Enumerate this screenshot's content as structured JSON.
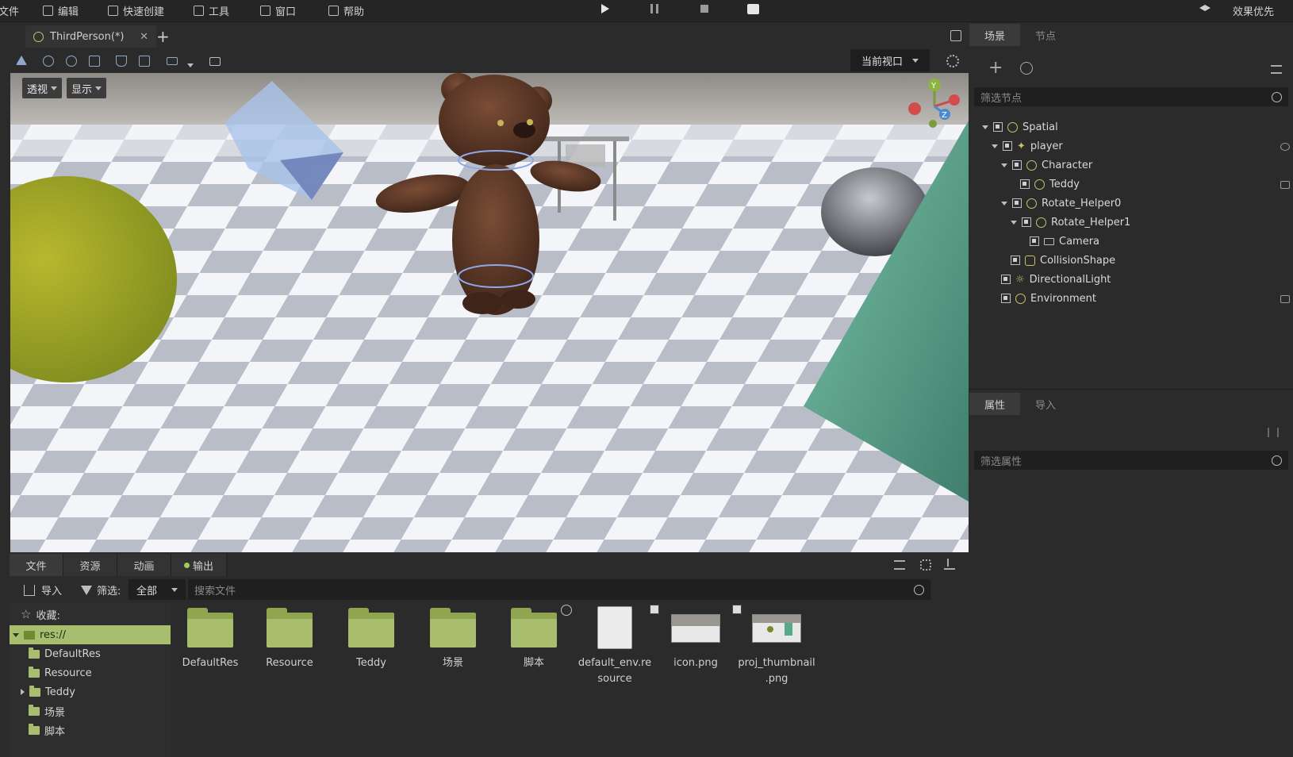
{
  "menubar": {
    "items": [
      "文件",
      "编辑",
      "快速创建",
      "工具",
      "窗口",
      "帮助"
    ],
    "right_label": "效果优先"
  },
  "editor_tabs": {
    "scene_tab": "ThirdPerson(*)",
    "add_tab": "+"
  },
  "toolbar": {
    "viewport_select": "当前视口"
  },
  "viewport": {
    "perspective_btn": "透视",
    "display_btn": "显示",
    "gizmo": {
      "y": "Y",
      "z": "Z"
    }
  },
  "bottom_panel": {
    "tabs": [
      "文件",
      "资源",
      "动画",
      "输出"
    ],
    "import_label": "导入",
    "filter_label": "筛选:",
    "filter_value": "全部",
    "search_placeholder": "搜索文件",
    "favorites_label": "收藏:",
    "tree": [
      {
        "label": "res://",
        "selected": true
      },
      {
        "label": "DefaultRes"
      },
      {
        "label": "Resource"
      },
      {
        "label": "Teddy"
      },
      {
        "label": "场景"
      },
      {
        "label": "脚本"
      }
    ],
    "files": [
      {
        "name": "DefaultRes",
        "type": "folder"
      },
      {
        "name": "Resource",
        "type": "folder"
      },
      {
        "name": "Teddy",
        "type": "folder"
      },
      {
        "name": "场景",
        "type": "folder"
      },
      {
        "name": "脚本",
        "type": "folder"
      },
      {
        "name": "default_env.re\nsource",
        "type": "resource"
      },
      {
        "name": "icon.png",
        "type": "image"
      },
      {
        "name": "proj_thumbnail\n.png",
        "type": "image"
      }
    ]
  },
  "scene_panel": {
    "tabs": [
      "场景",
      "节点"
    ],
    "filter_placeholder": "筛选节点",
    "nodes": [
      {
        "label": "Spatial"
      },
      {
        "label": "player"
      },
      {
        "label": "Character"
      },
      {
        "label": "Teddy"
      },
      {
        "label": "Rotate_Helper0"
      },
      {
        "label": "Rotate_Helper1"
      },
      {
        "label": "Camera"
      },
      {
        "label": "CollisionShape"
      },
      {
        "label": "DirectionalLight"
      },
      {
        "label": "Environment"
      }
    ]
  },
  "inspector_panel": {
    "tabs": [
      "属性",
      "导入"
    ],
    "filter_placeholder": "筛选属性"
  },
  "colors": {
    "accent_green": "#a8bd6e",
    "panel_bg": "#2b2b2b",
    "menubar_bg": "#252526"
  }
}
